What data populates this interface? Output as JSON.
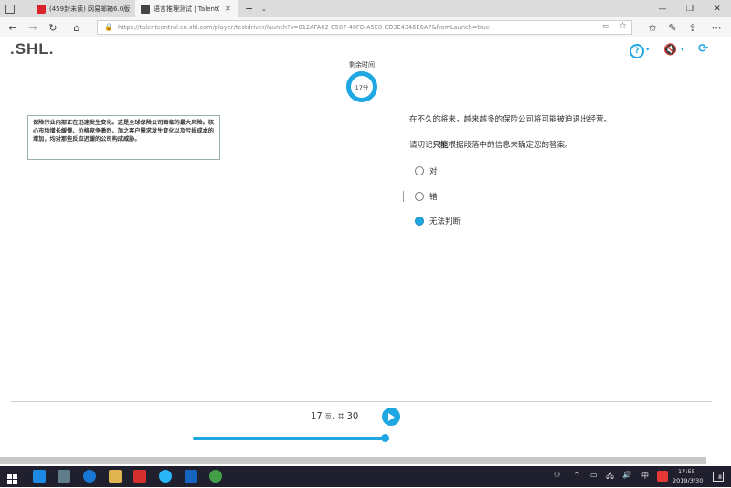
{
  "browser": {
    "tabs": [
      {
        "label": "(459封未读) 网易邮箱6.0版",
        "active": false
      },
      {
        "label": "语言推理测试 | TalentC",
        "active": true
      }
    ],
    "url": "https://talentcentral.cn.shl.com/player/testdriver/launch?s=812AFA02-C587-48FD-A5E8-CD3E4346E6A7&fromLaunch=true",
    "new_tab_label": "+",
    "icons": [
      "back-icon",
      "forward-icon",
      "refresh-icon",
      "home-icon",
      "lock-icon",
      "reading-view-icon",
      "favorite-icon",
      "favorites-list-icon",
      "notes-icon",
      "share-icon",
      "more-icon"
    ]
  },
  "app": {
    "logo": ".SHL.",
    "header_icons": [
      "help-icon",
      "sound-off-icon",
      "exit-icon"
    ]
  },
  "timer": {
    "label": "剩余时间",
    "value": "17分"
  },
  "passage": {
    "text": "保险行业内部正在迅速发生变化。这是全球保险公司面临的最大风险。核心市场增长缓慢、价格竞争激烈、加之客户需求发生变化以及亏损成本的增加，均对那些反应迟缓的公司构成威胁。"
  },
  "question": {
    "statement": "在不久的将来，越来越多的保险公司将可能被迫退出经营。",
    "instruction_prefix": "请切记",
    "instruction_bold": "只能",
    "instruction_suffix": "根据段落中的信息来确定您的答案。",
    "options": [
      {
        "label": "对",
        "selected": false
      },
      {
        "label": "错",
        "selected": false
      },
      {
        "label": "无法判断",
        "selected": true
      }
    ]
  },
  "navigation": {
    "current_page": "17",
    "page_text": "页，共",
    "total_pages": "30",
    "progress": 0.567
  },
  "taskbar": {
    "time": "17:55",
    "date": "2019/3/30",
    "ime": "中",
    "notification_count": "8"
  },
  "colors": {
    "accent": "#1ea7e1",
    "logo_green": "#8bc34a",
    "taskbar": "#1f1f2e"
  }
}
